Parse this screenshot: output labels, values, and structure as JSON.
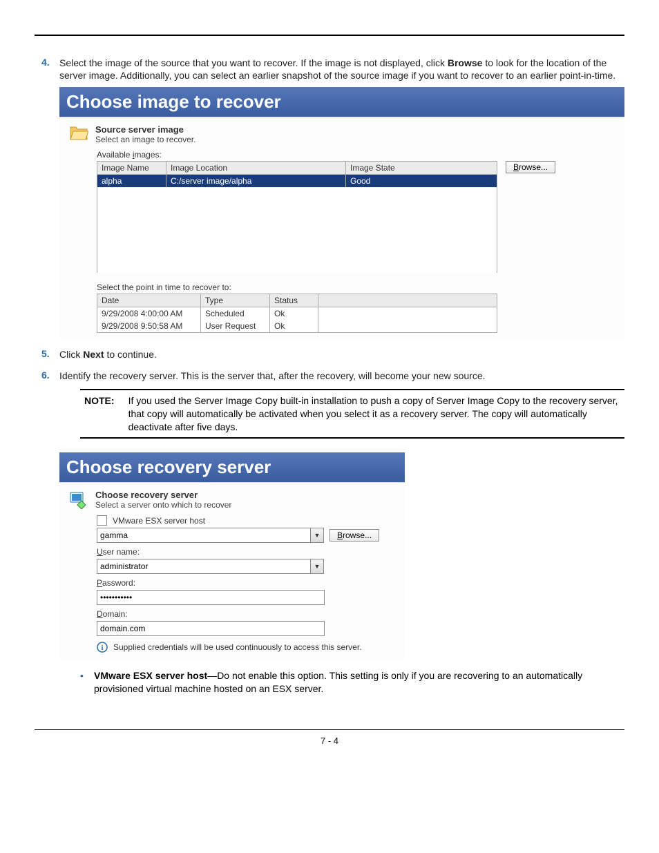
{
  "steps": {
    "step4": {
      "num": "4.",
      "text_before_bold": "Select the image of the source that you want to recover. If the image is not displayed, click ",
      "bold": "Browse",
      "text_after_bold": " to look for the location of the server image. Additionally, you can select an earlier snapshot of the source image if you want to recover to an earlier point-in-time."
    },
    "step5": {
      "num": "5.",
      "text_before_bold": "Click ",
      "bold": "Next",
      "text_after_bold": " to continue."
    },
    "step6": {
      "num": "6.",
      "text": "Identify the recovery server. This is the server that, after the recovery, will become your new source."
    }
  },
  "shot1": {
    "title": "Choose image to recover",
    "section_title": "Source server image",
    "section_sub": "Select an image to recover.",
    "available_label": "Available images:",
    "available_ul_char": "i",
    "browse_label": "Browse...",
    "browse_ul_char": "B",
    "headers": {
      "name": "Image Name",
      "location": "Image Location",
      "state": "Image State"
    },
    "row": {
      "name": "alpha",
      "location": "C:/server image/alpha",
      "state": "Good"
    },
    "pit_label": "Select the point in time to recover to:",
    "pit_ul_char": "p",
    "pit_headers": {
      "date": "Date",
      "type": "Type",
      "status": "Status",
      "blank": ""
    },
    "pit_rows": [
      {
        "date": "9/29/2008 4:00:00 AM",
        "type": "Scheduled",
        "status": "Ok"
      },
      {
        "date": "9/29/2008 9:50:58 AM",
        "type": "User Request",
        "status": "Ok"
      }
    ]
  },
  "note": {
    "label": "NOTE:",
    "text": "If you used the Server Image Copy built-in installation to push a copy of Server Image Copy to the recovery server, that copy will automatically be activated when you select it as a recovery server. The copy will automatically deactivate after five days."
  },
  "shot2": {
    "title": "Choose recovery server",
    "section_title": "Choose recovery server",
    "section_sub": "Select a server onto which to recover",
    "esx_label": "VMware ESX server host",
    "esx_ul_char": "E",
    "host_value": "gamma",
    "browse_label": "Browse...",
    "browse_ul_char": "B",
    "user_label": "User name:",
    "user_ul_char": "U",
    "user_value": "administrator",
    "pass_label": "Password:",
    "pass_ul_char": "P",
    "pass_value": "•••••••••••",
    "domain_label": "Domain:",
    "domain_ul_char": "D",
    "domain_value": "domain.com",
    "info_text": "Supplied credentials will be used continuously to access this server."
  },
  "bullet1": {
    "bold": "VMware ESX server host",
    "text": "—Do not enable this option. This setting is only if you are recovering to an automatically provisioned virtual machine hosted on an ESX server."
  },
  "page_number": "7 - 4"
}
